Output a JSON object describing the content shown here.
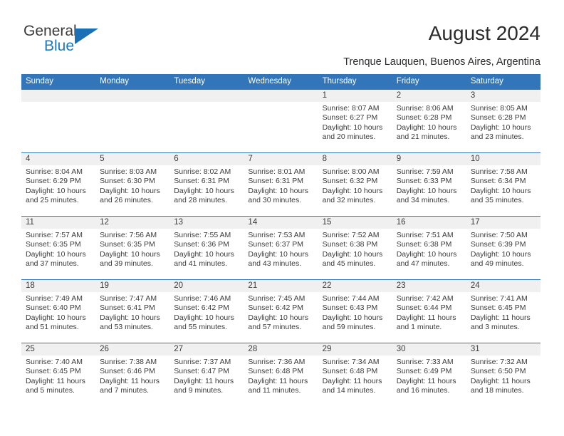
{
  "brand": {
    "name_part1": "General",
    "name_part2": "Blue",
    "triangle_color": "#1a6fb5",
    "text_color": "#3b3b3b",
    "accent_color": "#1b78c2"
  },
  "header": {
    "title": "August 2024",
    "subtitle": "Trenque Lauquen, Buenos Aires, Argentina",
    "header_bg_color": "#3275b8",
    "header_text_color": "#ffffff",
    "daystrip_color": "#f0f0f0"
  },
  "weekdays": [
    "Sunday",
    "Monday",
    "Tuesday",
    "Wednesday",
    "Thursday",
    "Friday",
    "Saturday"
  ],
  "weeks": [
    [
      {
        "day": "",
        "sunrise": "",
        "sunset": "",
        "daylight_l1": "",
        "daylight_l2": ""
      },
      {
        "day": "",
        "sunrise": "",
        "sunset": "",
        "daylight_l1": "",
        "daylight_l2": ""
      },
      {
        "day": "",
        "sunrise": "",
        "sunset": "",
        "daylight_l1": "",
        "daylight_l2": ""
      },
      {
        "day": "",
        "sunrise": "",
        "sunset": "",
        "daylight_l1": "",
        "daylight_l2": ""
      },
      {
        "day": "1",
        "sunrise": "Sunrise: 8:07 AM",
        "sunset": "Sunset: 6:27 PM",
        "daylight_l1": "Daylight: 10 hours",
        "daylight_l2": "and 20 minutes."
      },
      {
        "day": "2",
        "sunrise": "Sunrise: 8:06 AM",
        "sunset": "Sunset: 6:28 PM",
        "daylight_l1": "Daylight: 10 hours",
        "daylight_l2": "and 21 minutes."
      },
      {
        "day": "3",
        "sunrise": "Sunrise: 8:05 AM",
        "sunset": "Sunset: 6:28 PM",
        "daylight_l1": "Daylight: 10 hours",
        "daylight_l2": "and 23 minutes."
      }
    ],
    [
      {
        "day": "4",
        "sunrise": "Sunrise: 8:04 AM",
        "sunset": "Sunset: 6:29 PM",
        "daylight_l1": "Daylight: 10 hours",
        "daylight_l2": "and 25 minutes."
      },
      {
        "day": "5",
        "sunrise": "Sunrise: 8:03 AM",
        "sunset": "Sunset: 6:30 PM",
        "daylight_l1": "Daylight: 10 hours",
        "daylight_l2": "and 26 minutes."
      },
      {
        "day": "6",
        "sunrise": "Sunrise: 8:02 AM",
        "sunset": "Sunset: 6:31 PM",
        "daylight_l1": "Daylight: 10 hours",
        "daylight_l2": "and 28 minutes."
      },
      {
        "day": "7",
        "sunrise": "Sunrise: 8:01 AM",
        "sunset": "Sunset: 6:31 PM",
        "daylight_l1": "Daylight: 10 hours",
        "daylight_l2": "and 30 minutes."
      },
      {
        "day": "8",
        "sunrise": "Sunrise: 8:00 AM",
        "sunset": "Sunset: 6:32 PM",
        "daylight_l1": "Daylight: 10 hours",
        "daylight_l2": "and 32 minutes."
      },
      {
        "day": "9",
        "sunrise": "Sunrise: 7:59 AM",
        "sunset": "Sunset: 6:33 PM",
        "daylight_l1": "Daylight: 10 hours",
        "daylight_l2": "and 34 minutes."
      },
      {
        "day": "10",
        "sunrise": "Sunrise: 7:58 AM",
        "sunset": "Sunset: 6:34 PM",
        "daylight_l1": "Daylight: 10 hours",
        "daylight_l2": "and 35 minutes."
      }
    ],
    [
      {
        "day": "11",
        "sunrise": "Sunrise: 7:57 AM",
        "sunset": "Sunset: 6:35 PM",
        "daylight_l1": "Daylight: 10 hours",
        "daylight_l2": "and 37 minutes."
      },
      {
        "day": "12",
        "sunrise": "Sunrise: 7:56 AM",
        "sunset": "Sunset: 6:35 PM",
        "daylight_l1": "Daylight: 10 hours",
        "daylight_l2": "and 39 minutes."
      },
      {
        "day": "13",
        "sunrise": "Sunrise: 7:55 AM",
        "sunset": "Sunset: 6:36 PM",
        "daylight_l1": "Daylight: 10 hours",
        "daylight_l2": "and 41 minutes."
      },
      {
        "day": "14",
        "sunrise": "Sunrise: 7:53 AM",
        "sunset": "Sunset: 6:37 PM",
        "daylight_l1": "Daylight: 10 hours",
        "daylight_l2": "and 43 minutes."
      },
      {
        "day": "15",
        "sunrise": "Sunrise: 7:52 AM",
        "sunset": "Sunset: 6:38 PM",
        "daylight_l1": "Daylight: 10 hours",
        "daylight_l2": "and 45 minutes."
      },
      {
        "day": "16",
        "sunrise": "Sunrise: 7:51 AM",
        "sunset": "Sunset: 6:38 PM",
        "daylight_l1": "Daylight: 10 hours",
        "daylight_l2": "and 47 minutes."
      },
      {
        "day": "17",
        "sunrise": "Sunrise: 7:50 AM",
        "sunset": "Sunset: 6:39 PM",
        "daylight_l1": "Daylight: 10 hours",
        "daylight_l2": "and 49 minutes."
      }
    ],
    [
      {
        "day": "18",
        "sunrise": "Sunrise: 7:49 AM",
        "sunset": "Sunset: 6:40 PM",
        "daylight_l1": "Daylight: 10 hours",
        "daylight_l2": "and 51 minutes."
      },
      {
        "day": "19",
        "sunrise": "Sunrise: 7:47 AM",
        "sunset": "Sunset: 6:41 PM",
        "daylight_l1": "Daylight: 10 hours",
        "daylight_l2": "and 53 minutes."
      },
      {
        "day": "20",
        "sunrise": "Sunrise: 7:46 AM",
        "sunset": "Sunset: 6:42 PM",
        "daylight_l1": "Daylight: 10 hours",
        "daylight_l2": "and 55 minutes."
      },
      {
        "day": "21",
        "sunrise": "Sunrise: 7:45 AM",
        "sunset": "Sunset: 6:42 PM",
        "daylight_l1": "Daylight: 10 hours",
        "daylight_l2": "and 57 minutes."
      },
      {
        "day": "22",
        "sunrise": "Sunrise: 7:44 AM",
        "sunset": "Sunset: 6:43 PM",
        "daylight_l1": "Daylight: 10 hours",
        "daylight_l2": "and 59 minutes."
      },
      {
        "day": "23",
        "sunrise": "Sunrise: 7:42 AM",
        "sunset": "Sunset: 6:44 PM",
        "daylight_l1": "Daylight: 11 hours",
        "daylight_l2": "and 1 minute."
      },
      {
        "day": "24",
        "sunrise": "Sunrise: 7:41 AM",
        "sunset": "Sunset: 6:45 PM",
        "daylight_l1": "Daylight: 11 hours",
        "daylight_l2": "and 3 minutes."
      }
    ],
    [
      {
        "day": "25",
        "sunrise": "Sunrise: 7:40 AM",
        "sunset": "Sunset: 6:45 PM",
        "daylight_l1": "Daylight: 11 hours",
        "daylight_l2": "and 5 minutes."
      },
      {
        "day": "26",
        "sunrise": "Sunrise: 7:38 AM",
        "sunset": "Sunset: 6:46 PM",
        "daylight_l1": "Daylight: 11 hours",
        "daylight_l2": "and 7 minutes."
      },
      {
        "day": "27",
        "sunrise": "Sunrise: 7:37 AM",
        "sunset": "Sunset: 6:47 PM",
        "daylight_l1": "Daylight: 11 hours",
        "daylight_l2": "and 9 minutes."
      },
      {
        "day": "28",
        "sunrise": "Sunrise: 7:36 AM",
        "sunset": "Sunset: 6:48 PM",
        "daylight_l1": "Daylight: 11 hours",
        "daylight_l2": "and 11 minutes."
      },
      {
        "day": "29",
        "sunrise": "Sunrise: 7:34 AM",
        "sunset": "Sunset: 6:48 PM",
        "daylight_l1": "Daylight: 11 hours",
        "daylight_l2": "and 14 minutes."
      },
      {
        "day": "30",
        "sunrise": "Sunrise: 7:33 AM",
        "sunset": "Sunset: 6:49 PM",
        "daylight_l1": "Daylight: 11 hours",
        "daylight_l2": "and 16 minutes."
      },
      {
        "day": "31",
        "sunrise": "Sunrise: 7:32 AM",
        "sunset": "Sunset: 6:50 PM",
        "daylight_l1": "Daylight: 11 hours",
        "daylight_l2": "and 18 minutes."
      }
    ]
  ]
}
